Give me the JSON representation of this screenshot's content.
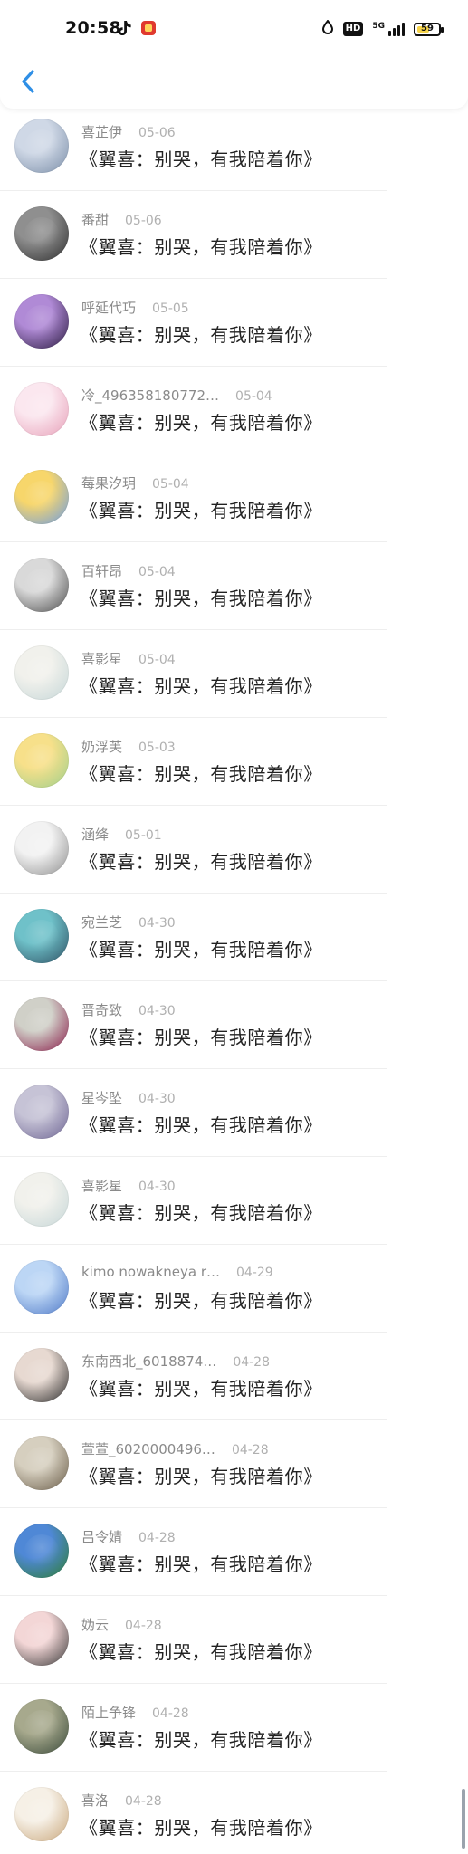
{
  "status_bar": {
    "time": "20:58",
    "network_label": "5G",
    "hd_label": "HD",
    "battery_text": "59",
    "battery_level": 0.59,
    "icons": [
      "tiktok-icon",
      "red-app-icon",
      "water-drop-icon",
      "hd-icon",
      "signal-icon",
      "battery-icon"
    ]
  },
  "app_bar": {
    "back_icon": "chevron-left-icon",
    "accent_color": "#2f8fe6"
  },
  "list": {
    "items": [
      {
        "username": "喜芷伊",
        "date": "05-06",
        "comment": "《翼喜：别哭，有我陪着你》",
        "avatar_colors": [
          "#cfd8e6",
          "#7b8ea8"
        ]
      },
      {
        "username": "番甜",
        "date": "05-06",
        "comment": "《翼喜：别哭，有我陪着你》",
        "avatar_colors": [
          "#8f8f8f",
          "#2e2e2e"
        ]
      },
      {
        "username": "呼延代巧",
        "date": "05-05",
        "comment": "《翼喜：别哭，有我陪着你》",
        "avatar_colors": [
          "#b08ad6",
          "#2a1b3f"
        ]
      },
      {
        "username": "冷_496358180772…",
        "date": "05-04",
        "comment": "《翼喜：别哭，有我陪着你》",
        "avatar_colors": [
          "#fbe7ef",
          "#e7a0b8"
        ]
      },
      {
        "username": "莓果汐玥",
        "date": "05-04",
        "comment": "《翼喜：别哭，有我陪着你》",
        "avatar_colors": [
          "#f7d66b",
          "#6b9be6"
        ]
      },
      {
        "username": "百轩昂",
        "date": "05-04",
        "comment": "《翼喜：别哭，有我陪着你》",
        "avatar_colors": [
          "#d9d9d9",
          "#4d4d4d"
        ]
      },
      {
        "username": "喜影星",
        "date": "05-04",
        "comment": "《翼喜：别哭，有我陪着你》",
        "avatar_colors": [
          "#f1f1ec",
          "#c6d7d8"
        ]
      },
      {
        "username": "奶浮芙",
        "date": "05-03",
        "comment": "《翼喜：别哭，有我陪着你》",
        "avatar_colors": [
          "#f7e08a",
          "#9ecf8c"
        ]
      },
      {
        "username": "涵绛",
        "date": "05-01",
        "comment": "《翼喜：别哭，有我陪着你》",
        "avatar_colors": [
          "#f2f2f2",
          "#8e8e8e"
        ]
      },
      {
        "username": "宛兰芝",
        "date": "04-30",
        "comment": "《翼喜：别哭，有我陪着你》",
        "avatar_colors": [
          "#6fc1c9",
          "#2d4f62"
        ]
      },
      {
        "username": "晋奇致",
        "date": "04-30",
        "comment": "《翼喜：别哭，有我陪着你》",
        "avatar_colors": [
          "#d0d0c8",
          "#8a1c4a"
        ]
      },
      {
        "username": "星岑坠",
        "date": "04-30",
        "comment": "《翼喜：别哭，有我陪着你》",
        "avatar_colors": [
          "#c6c3d6",
          "#6f6694"
        ]
      },
      {
        "username": "喜影星",
        "date": "04-30",
        "comment": "《翼喜：别哭，有我陪着你》",
        "avatar_colors": [
          "#f1f1ec",
          "#c6d7d8"
        ]
      },
      {
        "username": "kimo nowakneya r…",
        "date": "04-29",
        "comment": "《翼喜：别哭，有我陪着你》",
        "avatar_colors": [
          "#bcd6f5",
          "#4f79c7"
        ]
      },
      {
        "username": "东南西北_6018874…",
        "date": "04-28",
        "comment": "《翼喜：别哭，有我陪着你》",
        "avatar_colors": [
          "#e7d9d1",
          "#2a2a2a"
        ]
      },
      {
        "username": "萱萱_6020000496…",
        "date": "04-28",
        "comment": "《翼喜：别哭，有我陪着你》",
        "avatar_colors": [
          "#d6cfbf",
          "#6b5e4a"
        ]
      },
      {
        "username": "吕令婧",
        "date": "04-28",
        "comment": "《翼喜：别哭，有我陪着你》",
        "avatar_colors": [
          "#4f88d6",
          "#2e7d32"
        ]
      },
      {
        "username": "妫云",
        "date": "04-28",
        "comment": "《翼喜：别哭，有我陪着你》",
        "avatar_colors": [
          "#f3d6d6",
          "#3a3a3a"
        ]
      },
      {
        "username": "陌上争锋",
        "date": "04-28",
        "comment": "《翼喜：别哭，有我陪着你》",
        "avatar_colors": [
          "#a7a98d",
          "#3a4a3a"
        ]
      },
      {
        "username": "喜洛",
        "date": "04-28",
        "comment": "《翼喜：别哭，有我陪着你》",
        "avatar_colors": [
          "#f6f0e6",
          "#c9a77c"
        ]
      }
    ]
  }
}
